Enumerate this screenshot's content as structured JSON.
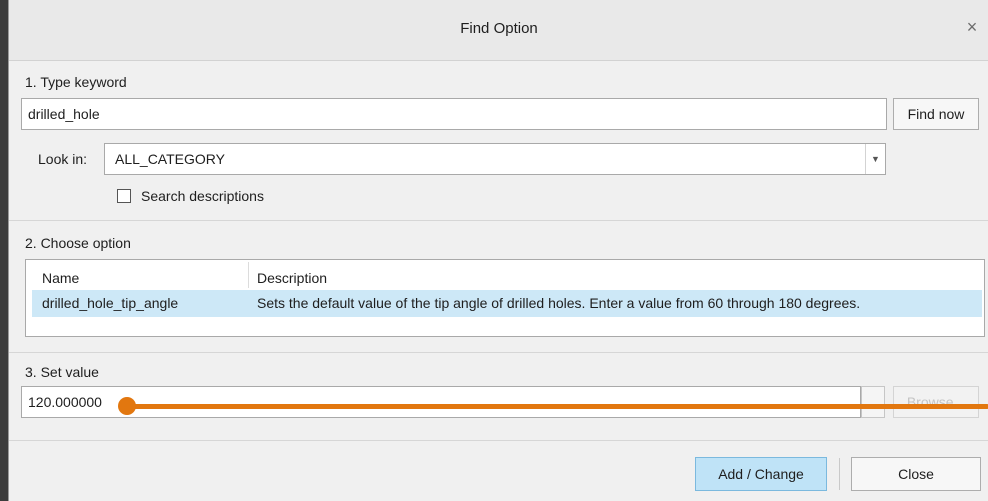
{
  "dialog": {
    "title": "Find Option",
    "close_glyph": "×",
    "close_icon": "close-icon"
  },
  "step1": {
    "label": "1.  Type keyword",
    "keyword": "drilled_hole",
    "find_now_label": "Find now",
    "look_in_label": "Look in:",
    "look_in_value": "ALL_CATEGORY",
    "dropdown_icon": "chevron-down-icon",
    "dropdown_glyph": "▼",
    "search_desc_label": "Search descriptions",
    "search_desc_checked": false
  },
  "step2": {
    "label": "2.  Choose option",
    "columns": [
      "Name",
      "Description"
    ],
    "rows": [
      {
        "name": "drilled_hole_tip_angle",
        "description": "Sets the default value of the tip angle of drilled holes. Enter a value from 60 through 180 degrees.",
        "selected": true
      }
    ]
  },
  "step3": {
    "label": "3.  Set value",
    "value": "120.000000",
    "browse_label": "Browse...",
    "browse_enabled": false
  },
  "footer": {
    "add_change_label": "Add / Change",
    "close_label": "Close"
  },
  "annotation": {
    "color": "#e2770f"
  }
}
